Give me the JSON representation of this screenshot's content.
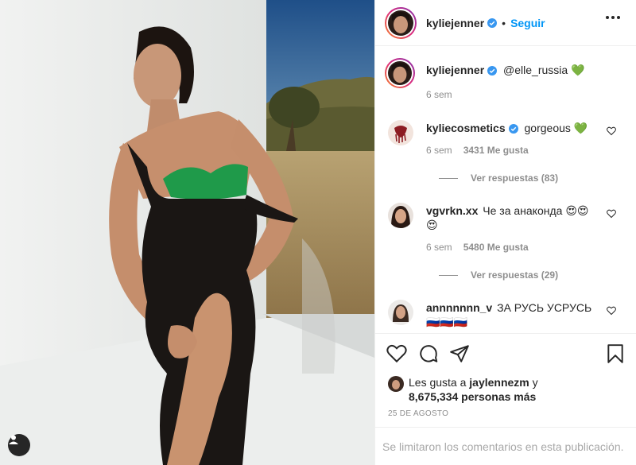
{
  "post": {
    "author": "kyliejenner",
    "dot": "•",
    "follow_label": "Seguir",
    "caption_text": "@elle_russia 💚",
    "caption_time": "6 sem"
  },
  "comments": [
    {
      "user": "kyliecosmetics",
      "text": "gorgeous 💚",
      "time": "6 sem",
      "likes": "3431 Me gusta",
      "replies": "Ver respuestas (83)"
    },
    {
      "user": "vgvrkn.xx",
      "text": "Че за анаконда 😍😍😍",
      "time": "6 sem",
      "likes": "5480 Me gusta",
      "replies": "Ver respuestas (29)"
    },
    {
      "user": "annnnnnn_v",
      "text": "ЗА РУСЬ УСРУСЬ🇷🇺🇷🇺🇷🇺"
    }
  ],
  "likes": {
    "prefix": "Les gusta a ",
    "user": "jaylennezm",
    "middle": " y",
    "count_text": "8,675,334 personas más"
  },
  "date": "25 DE AGOSTO",
  "comments_limited": "Se limitaron los comentarios en esta publicación.",
  "icons": [
    "verified-icon",
    "more-icon",
    "heart-icon",
    "comment-icon",
    "share-icon",
    "save-icon",
    "user-tag-icon"
  ],
  "colors": {
    "accent": "#0095f6",
    "verified": "#3897f0",
    "text": "#262626",
    "muted": "#8e8e8e"
  }
}
